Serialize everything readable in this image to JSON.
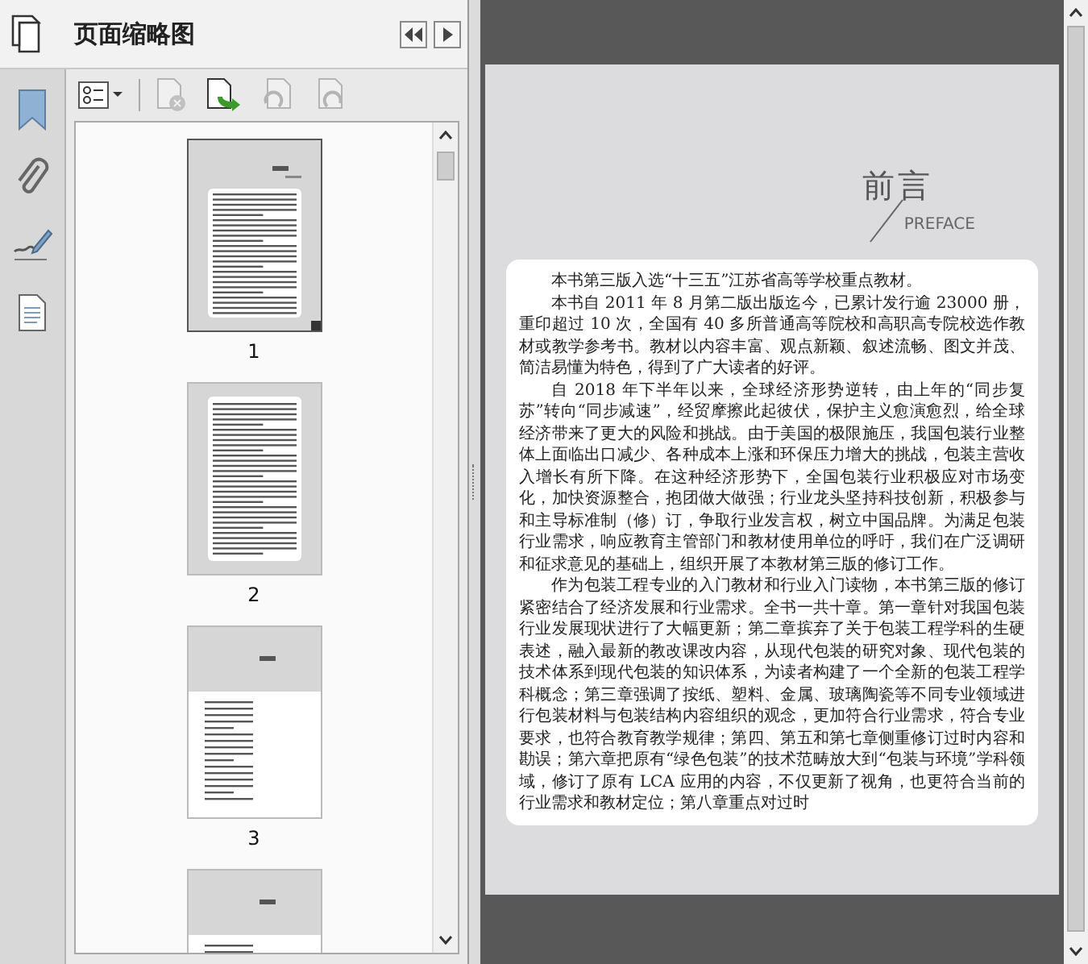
{
  "panel": {
    "title": "页面缩略图"
  },
  "toolbar": [
    {
      "kind": "options",
      "disabled": false
    },
    {
      "kind": "delete",
      "disabled": true
    },
    {
      "kind": "insert",
      "disabled": false
    },
    {
      "kind": "rotate-left",
      "disabled": true
    },
    {
      "kind": "rotate-right",
      "disabled": true
    }
  ],
  "rail": [
    {
      "kind": "bookmark",
      "selected": false
    },
    {
      "kind": "attachment",
      "selected": false
    },
    {
      "kind": "signature",
      "selected": false
    },
    {
      "kind": "page",
      "selected": false
    }
  ],
  "thumbnails": [
    {
      "kind": "preface",
      "label": "1",
      "selected": true
    },
    {
      "kind": "text",
      "label": "2",
      "selected": false
    },
    {
      "kind": "contents",
      "label": "3",
      "selected": false
    },
    {
      "kind": "contents",
      "selected": false
    }
  ],
  "page": {
    "heading": "前言",
    "subheading": "PREFACE",
    "paragraphs": [
      "本书第三版入选“十三五”江苏省高等学校重点教材。",
      "本书自 2011 年 8 月第二版出版迄今，已累计发行逾 23000 册，重印超过 10 次，全国有 40 多所普通高等院校和高职高专院校选作教材或教学参考书。教材以内容丰富、观点新颖、叙述流畅、图文并茂、简洁易懂为特色，得到了广大读者的好评。",
      "自 2018 年下半年以来，全球经济形势逆转，由上年的“同步复苏”转向“同步减速”，经贸摩擦此起彼伏，保护主义愈演愈烈，给全球经济带来了更大的风险和挑战。由于美国的极限施压，我国包装行业整体上面临出口减少、各种成本上涨和环保压力增大的挑战，包装主营收入增长有所下降。在这种经济形势下，全国包装行业积极应对市场变化，加快资源整合，抱团做大做强；行业龙头坚持科技创新，积极参与和主导标准制（修）订，争取行业发言权，树立中国品牌。为满足包装行业需求，响应教育主管部门和教材使用单位的呼吁，我们在广泛调研和征求意见的基础上，组织开展了本教材第三版的修订工作。",
      "作为包装工程专业的入门教材和行业入门读物，本书第三版的修订紧密结合了经济发展和行业需求。全书一共十章。第一章针对我国包装行业发展现状进行了大幅更新；第二章摈弃了关于包装工程学科的生硬表述，融入最新的教改课改内容，从现代包装的研究对象、现代包装的技术体系到现代包装的知识体系，为读者构建了一个全新的包装工程学科概念；第三章强调了按纸、塑料、金属、玻璃陶瓷等不同专业领域进行包装材料与包装结构内容组织的观念，更加符合行业需求，符合专业要求，也符合教育教学规律；第四、第五和第七章侧重修订过时内容和勘误；第六章把原有“绿色包装”的技术范畴放大到“包装与环境”学科领域，修订了原有 LCA 应用的内容，不仅更新了视角，也更符合当前的行业需求和教材定位；第八章重点对过时"
    ]
  }
}
